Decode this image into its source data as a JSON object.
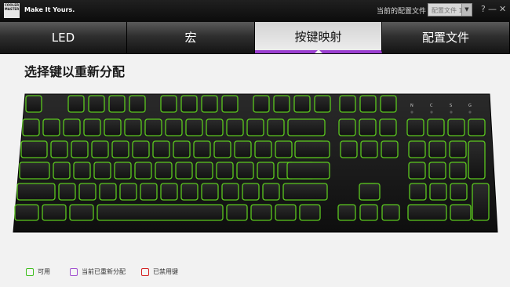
{
  "app": {
    "logo_lines": [
      "COOLER",
      "MASTER"
    ],
    "slogan": "Make It Yours.",
    "current_profile_label": "当前的配置文件",
    "current_profile_value": "配置文件 1",
    "help_icon": "?",
    "minimize_icon": "—",
    "close_icon": "✕"
  },
  "tabs": [
    {
      "label": "LED",
      "active": false
    },
    {
      "label": "宏",
      "active": false
    },
    {
      "label": "按键映射",
      "active": true
    },
    {
      "label": "配置文件",
      "active": false
    }
  ],
  "page_title": "选择键以重新分配",
  "indicators": [
    "N",
    "C",
    "S",
    "G"
  ],
  "legend": [
    {
      "label": "可用",
      "color": "#3fbf1f"
    },
    {
      "label": "当前已重新分配",
      "color": "#a04fd0"
    },
    {
      "label": "已禁用键",
      "color": "#d42020"
    }
  ],
  "key_outline_color": "#5bc81e",
  "keyboard_color": "#151515"
}
